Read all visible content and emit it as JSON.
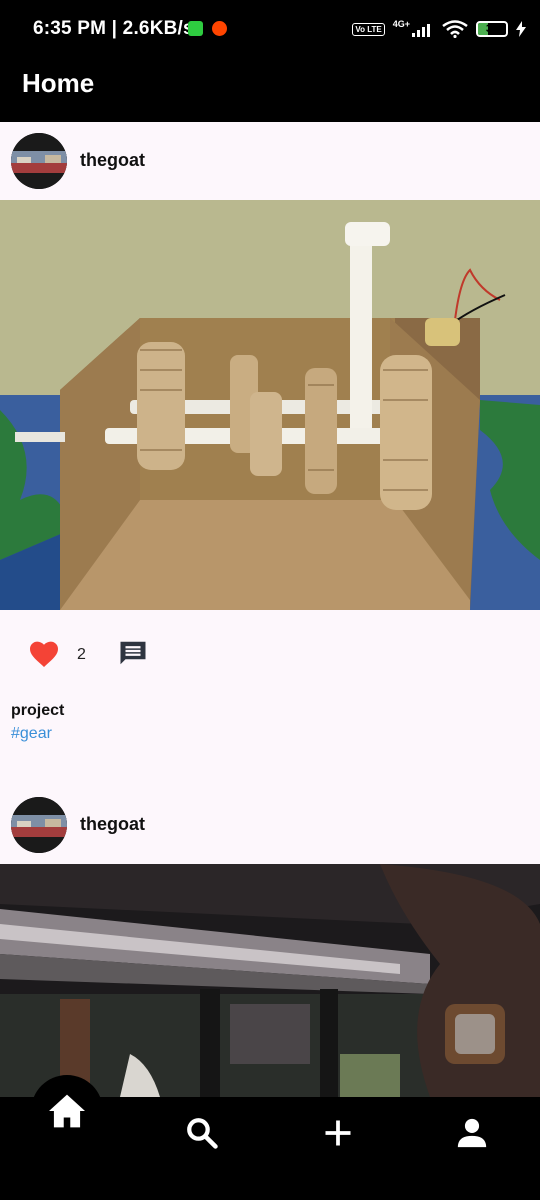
{
  "status_bar": {
    "time": "6:35 PM | 2.6KB/s",
    "network_label": "4G+",
    "volte_label": "Vo LTE",
    "battery_level": "35",
    "icons": [
      "messenger-icon",
      "reddit-icon",
      "signal-icon",
      "wifi-icon",
      "battery-icon",
      "charging-icon"
    ]
  },
  "app_bar": {
    "title": "Home"
  },
  "posts": [
    {
      "username": "thegoat",
      "likes": "2",
      "liked": true,
      "caption": "project",
      "hashtag": "#gear"
    },
    {
      "username": "thegoat"
    }
  ],
  "bottom_nav": {
    "items": [
      "home-icon",
      "search-icon",
      "add-icon",
      "profile-icon"
    ],
    "active": "home"
  },
  "colors": {
    "background": "#fdf7fc",
    "bar": "#000000",
    "like": "#f44336",
    "hashtag": "#3a8fd8"
  }
}
